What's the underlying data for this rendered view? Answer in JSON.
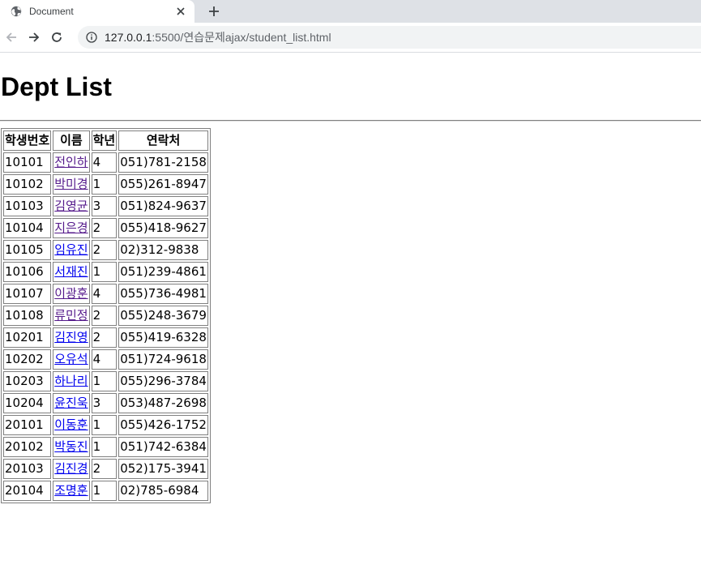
{
  "browser": {
    "tab_title": "Document",
    "url_host": "127.0.0.1",
    "url_rest": ":5500/연습문제ajax/student_list.html"
  },
  "page": {
    "heading": "Dept List",
    "table": {
      "headers": [
        "학생번호",
        "이름",
        "학년",
        "연락처"
      ],
      "rows": [
        {
          "id": "10101",
          "name": "전인하",
          "grade": "4",
          "phone": "051)781-2158",
          "visited": true
        },
        {
          "id": "10102",
          "name": "박미경",
          "grade": "1",
          "phone": "055)261-8947",
          "visited": true
        },
        {
          "id": "10103",
          "name": "김영균",
          "grade": "3",
          "phone": "051)824-9637",
          "visited": true
        },
        {
          "id": "10104",
          "name": "지은경",
          "grade": "2",
          "phone": "055)418-9627",
          "visited": true
        },
        {
          "id": "10105",
          "name": "임유진",
          "grade": "2",
          "phone": "02)312-9838",
          "visited": false
        },
        {
          "id": "10106",
          "name": "서재진",
          "grade": "1",
          "phone": "051)239-4861",
          "visited": false
        },
        {
          "id": "10107",
          "name": "이광훈",
          "grade": "4",
          "phone": "055)736-4981",
          "visited": true
        },
        {
          "id": "10108",
          "name": "류민정",
          "grade": "2",
          "phone": "055)248-3679",
          "visited": true
        },
        {
          "id": "10201",
          "name": "김진영",
          "grade": "2",
          "phone": "055)419-6328",
          "visited": false
        },
        {
          "id": "10202",
          "name": "오유석",
          "grade": "4",
          "phone": "051)724-9618",
          "visited": false
        },
        {
          "id": "10203",
          "name": "하나리",
          "grade": "1",
          "phone": "055)296-3784",
          "visited": false
        },
        {
          "id": "10204",
          "name": "윤진욱",
          "grade": "3",
          "phone": "053)487-2698",
          "visited": false
        },
        {
          "id": "20101",
          "name": "이동훈",
          "grade": "1",
          "phone": "055)426-1752",
          "visited": false
        },
        {
          "id": "20102",
          "name": "박동진",
          "grade": "1",
          "phone": "051)742-6384",
          "visited": false
        },
        {
          "id": "20103",
          "name": "김진경",
          "grade": "2",
          "phone": "052)175-3941",
          "visited": false
        },
        {
          "id": "20104",
          "name": "조명훈",
          "grade": "1",
          "phone": "02)785-6984",
          "visited": false
        }
      ]
    }
  },
  "colors": {
    "link": "#0000ee",
    "link_visited": "#551a8b"
  }
}
